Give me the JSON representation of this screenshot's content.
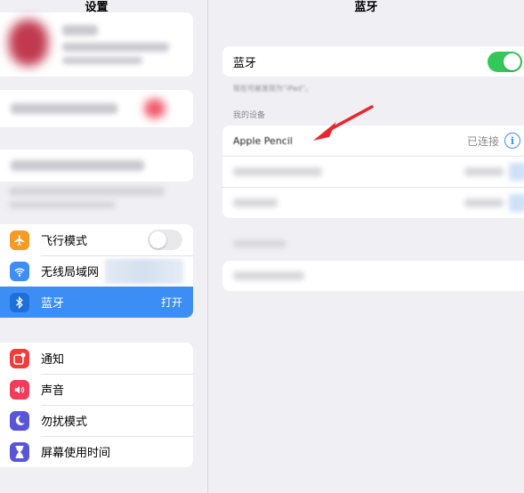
{
  "left": {
    "title": "设置",
    "settings_group_1": [
      {
        "name": "airplane",
        "label": "飞行模式",
        "icon": "airplane-icon",
        "color": "#f59a23",
        "control": "toggle",
        "on": false
      },
      {
        "name": "wifi",
        "label": "无线局域网",
        "icon": "wifi-icon",
        "color": "#3c8ef5",
        "control": "blur"
      },
      {
        "name": "bluetooth",
        "label": "蓝牙",
        "icon": "bluetooth-icon",
        "color": "#3c8ef5",
        "control": "value",
        "value": "打开",
        "selected": true
      }
    ],
    "settings_group_2": [
      {
        "name": "notifications",
        "label": "通知",
        "icon": "notification-icon",
        "color": "#f23c3c"
      },
      {
        "name": "sounds",
        "label": "声音",
        "icon": "speaker-icon",
        "color": "#f23c5a"
      },
      {
        "name": "do-not-disturb",
        "label": "勿扰模式",
        "icon": "moon-icon",
        "color": "#5856d6"
      },
      {
        "name": "screen-time",
        "label": "屏幕使用时间",
        "icon": "hourglass-icon",
        "color": "#5856d6"
      }
    ]
  },
  "right": {
    "title": "蓝牙",
    "bluetooth_label": "蓝牙",
    "bluetooth_on": true,
    "discoverable_note": "现在可被发现为“iPad”。",
    "my_devices_header": "我的设备",
    "device": {
      "name": "Apple Pencil",
      "status": "已连接"
    }
  },
  "colors": {
    "accent": "#3c8ef5",
    "toggle_on": "#34c759",
    "arrow": "#e8262d"
  }
}
